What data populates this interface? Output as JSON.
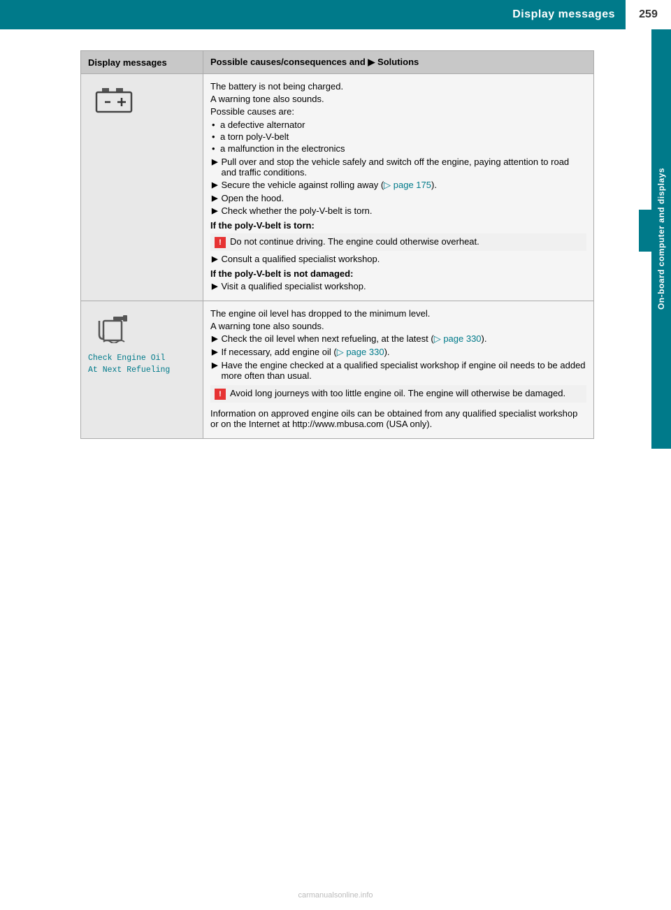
{
  "header": {
    "title": "Display messages",
    "page_number": "259",
    "sidebar_label": "On-board computer and displays"
  },
  "table": {
    "col1_header": "Display messages",
    "col2_header": "Possible causes/consequences and ▶ Solutions",
    "rows": [
      {
        "id": "battery",
        "display_icon": "battery",
        "display_label": null,
        "content_paragraphs": [
          "The battery is not being charged.",
          "A warning tone also sounds.",
          "Possible causes are:"
        ],
        "bullet_items": [
          "a defective alternator",
          "a torn poly-V-belt",
          "a malfunction in the electronics"
        ],
        "arrow_items": [
          "Pull over and stop the vehicle safely and switch off the engine, paying attention to road and traffic conditions.",
          "Secure the vehicle against rolling away (▷ page 175).",
          "Open the hood.",
          "Check whether the poly-V-belt is torn."
        ],
        "bold_heading1": "If the poly-V-belt is torn:",
        "warning1": "Do not continue driving. The engine could otherwise overheat.",
        "arrow_after_warning1": "Consult a qualified specialist workshop.",
        "bold_heading2": "If the poly-V-belt is not damaged:",
        "arrow_after_heading2": "Visit a qualified specialist workshop."
      },
      {
        "id": "oil",
        "display_icon": "oil",
        "display_label": "Check Engine Oil\nAt Next Refueling",
        "content_paragraphs": [
          "The engine oil level has dropped to the minimum level.",
          "A warning tone also sounds."
        ],
        "arrow_items": [
          "Check the oil level when next refueling, at the latest (▷ page 330).",
          "If necessary, add engine oil (▷ page 330).",
          "Have the engine checked at a qualified specialist workshop if engine oil needs to be added more often than usual."
        ],
        "warning2": "Avoid long journeys with too little engine oil. The engine will otherwise be damaged.",
        "final_text": "Information on approved engine oils can be obtained from any qualified specialist workshop or on the Internet at http://www.mbusa.com (USA only)."
      }
    ]
  },
  "watermark": "carmanualsonline.info"
}
